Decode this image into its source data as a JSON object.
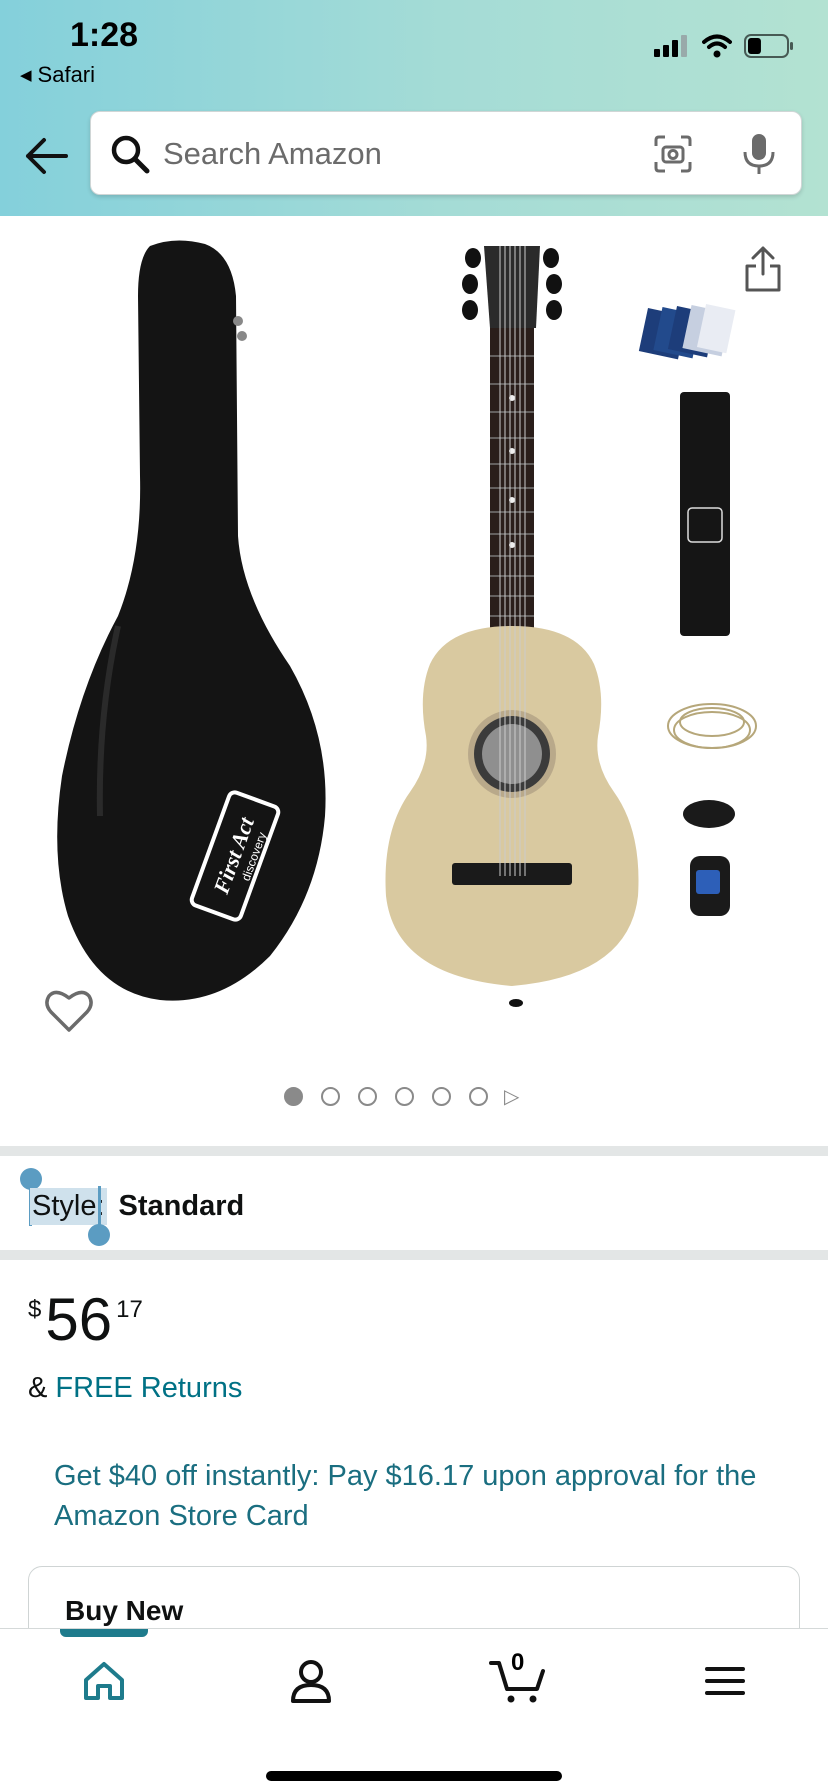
{
  "status_bar": {
    "time": "1:28",
    "back_app": "Safari",
    "battery_level": 0.35
  },
  "header": {
    "search_placeholder": "Search Amazon"
  },
  "gallery": {
    "image_count": 6,
    "active_index": 0
  },
  "product": {
    "style_label": "Style:",
    "style_value": "Standard",
    "price_currency": "$",
    "price_whole": "56",
    "price_fraction": "17",
    "returns_prefix": "&",
    "returns_link": "FREE Returns",
    "promo_text": "Get $40 off instantly: Pay $16.17 upon approval for the Amazon Store Card",
    "buy_box_title": "Buy New"
  },
  "tabbar": {
    "active_tab": "home",
    "cart_count": "0"
  },
  "colors": {
    "link": "#007185",
    "promo": "#1a6e80",
    "accent": "#1e7b8c",
    "selection": "#5b9cc2"
  }
}
